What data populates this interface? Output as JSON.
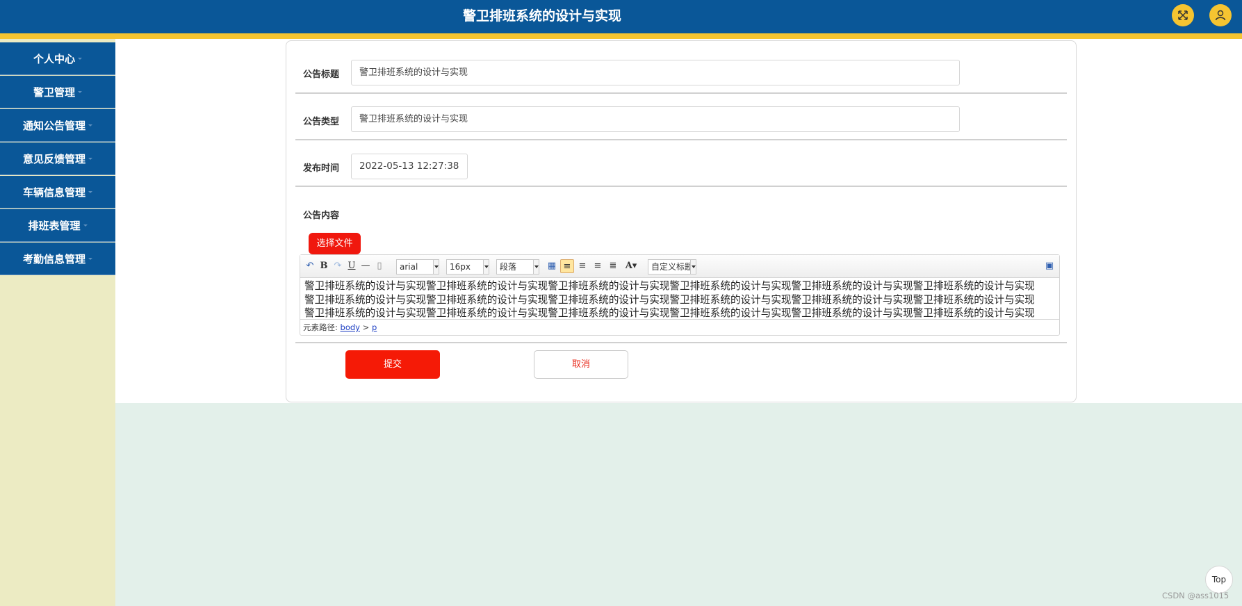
{
  "header": {
    "title": "警卫排班系统的设计与实现",
    "expand_icon": "fullscreen-icon",
    "user_icon": "user-icon"
  },
  "sidebar": {
    "items": [
      {
        "label": "个人中心"
      },
      {
        "label": "警卫管理"
      },
      {
        "label": "通知公告管理"
      },
      {
        "label": "意见反馈管理"
      },
      {
        "label": "车辆信息管理"
      },
      {
        "label": "排班表管理"
      },
      {
        "label": "考勤信息管理"
      }
    ]
  },
  "form": {
    "title_label": "公告标题",
    "title_value": "警卫排班系统的设计与实现",
    "type_label": "公告类型",
    "type_value": "警卫排班系统的设计与实现",
    "time_label": "发布时间",
    "time_value": "2022-05-13 12:27:38",
    "content_label": "公告内容",
    "file_button": "选择文件",
    "submit_button": "提交",
    "cancel_button": "取消"
  },
  "editor": {
    "font_family": "arial",
    "font_size": "16px",
    "paragraph": "段落",
    "custom_title": "自定义标题",
    "content_lines": [
      "警卫排班系统的设计与实现警卫排班系统的设计与实现警卫排班系统的设计与实现警卫排班系统的设计与实现警卫排班系统的设计与实现警卫排班系统的设计与实现",
      "警卫排班系统的设计与实现警卫排班系统的设计与实现警卫排班系统的设计与实现警卫排班系统的设计与实现警卫排班系统的设计与实现警卫排班系统的设计与实现",
      "警卫排班系统的设计与实现警卫排班系统的设计与实现警卫排班系统的设计与实现警卫排班系统的设计与实现警卫排班系统的设计与实现警卫排班系统的设计与实现"
    ],
    "path_label": "元素路径:",
    "path_body": "body",
    "path_sep": ">",
    "path_p": "p"
  },
  "footer": {
    "top_button": "Top",
    "watermark": "CSDN @ass1015"
  },
  "colors": {
    "header": "#0a5798",
    "stripe": "#f5c431",
    "accent_red": "#f51a06",
    "sidebar_bg": "#ecebc3",
    "page_bg": "#e3f0ea"
  }
}
